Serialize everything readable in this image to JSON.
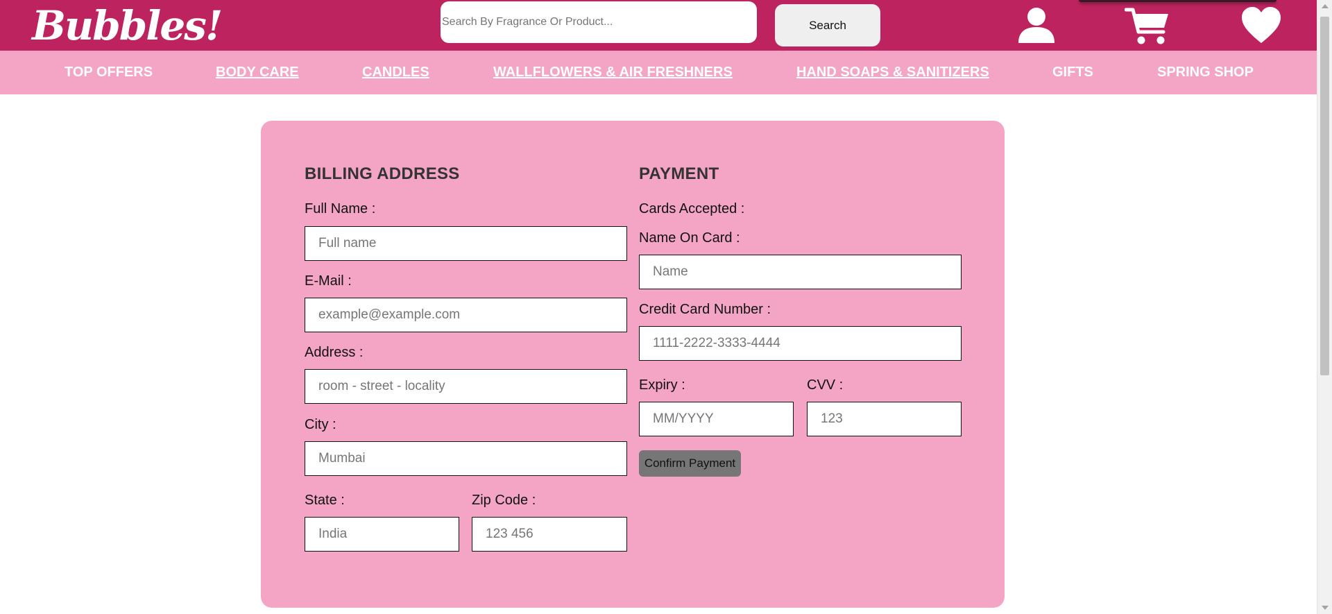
{
  "header": {
    "logo_text": "Bubbles!",
    "search": {
      "placeholder": "Search By Fragrance Or Product...",
      "value": ""
    },
    "search_button_label": "Search",
    "icons": [
      "user-icon",
      "cart-icon",
      "heart-icon"
    ]
  },
  "nav": {
    "items": [
      {
        "label": "TOP OFFERS"
      },
      {
        "label": "BODY CARE"
      },
      {
        "label": "CANDLES"
      },
      {
        "label": "WALLFLOWERS & AIR FRESHNERS"
      },
      {
        "label": "HAND SOAPS & SANITIZERS"
      },
      {
        "label": "GIFTS"
      },
      {
        "label": "SPRING SHOP"
      }
    ]
  },
  "billing": {
    "title": "BILLING ADDRESS",
    "full_name": {
      "label": "Full Name :",
      "placeholder": "Full name"
    },
    "email": {
      "label": "E-Mail :",
      "placeholder": "example@example.com"
    },
    "address": {
      "label": "Address :",
      "placeholder": "room - street - locality"
    },
    "city": {
      "label": "City :",
      "placeholder": "Mumbai"
    },
    "state": {
      "label": "State :",
      "placeholder": "India"
    },
    "zip": {
      "label": "Zip Code :",
      "placeholder": "123 456"
    }
  },
  "payment": {
    "title": "PAYMENT",
    "cards_accepted_label": "Cards Accepted :",
    "name_on_card": {
      "label": "Name On Card :",
      "placeholder": "Name"
    },
    "card_number": {
      "label": "Credit Card Number :",
      "placeholder": "1111-2222-3333-4444"
    },
    "expiry": {
      "label": "Expiry :",
      "placeholder": "MM/YYYY"
    },
    "cvv": {
      "label": "CVV :",
      "placeholder": "123"
    },
    "confirm_label": "Confirm Payment"
  },
  "colors": {
    "header_bg": "#bd245f",
    "nav_bg": "#f4a4c4",
    "card_bg": "#f4a4c4",
    "button_gray": "#767676"
  }
}
